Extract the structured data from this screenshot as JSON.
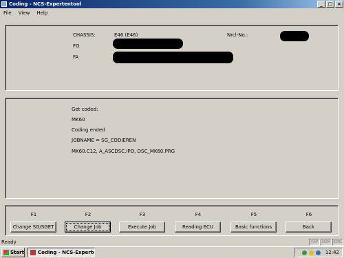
{
  "window": {
    "title": "Coding - NCS-Expertentool",
    "min_glyph": "_",
    "max_glyph": "□",
    "close_glyph": "×"
  },
  "menu": [
    "File",
    "View",
    "Help"
  ],
  "vehicle": {
    "chassis_label": "CHASSIS:",
    "chassis_value": "E46 (E46)",
    "fg_label": "FG",
    "fa_label": "FA",
    "nrcl_label": "Nrcl-No.:"
  },
  "log": [
    "Get coded:",
    "MK60",
    "Coding ended",
    "JOBNAME = SG_CODIEREN",
    "MK60.C12, A_ASCDSC.IPO, DSC_MK60.PRG"
  ],
  "function_keys": [
    {
      "key": "F1",
      "label": "Change SG/SGET"
    },
    {
      "key": "F2",
      "label": "Change Job"
    },
    {
      "key": "F3",
      "label": "Execute Job"
    },
    {
      "key": "F4",
      "label": "Reading ECU"
    },
    {
      "key": "F5",
      "label": "Basic functions"
    },
    {
      "key": "F6",
      "label": "Back"
    }
  ],
  "status": {
    "text": "Ready",
    "indicators": [
      "CAP",
      "NUM",
      "SCRL"
    ]
  },
  "taskbar": {
    "start_label": "Start",
    "task_label": "Coding - NCS-Experte...",
    "clock": "12:42"
  },
  "colors": {
    "titlebar_start": "#0a246a",
    "titlebar_end": "#a6caf0",
    "face": "#d4d0c8"
  },
  "icons": {
    "app": "app-icon",
    "minimize": "minimize-icon",
    "maximize": "maximize-icon",
    "close": "close-icon",
    "start": "windows-flag-icon"
  }
}
